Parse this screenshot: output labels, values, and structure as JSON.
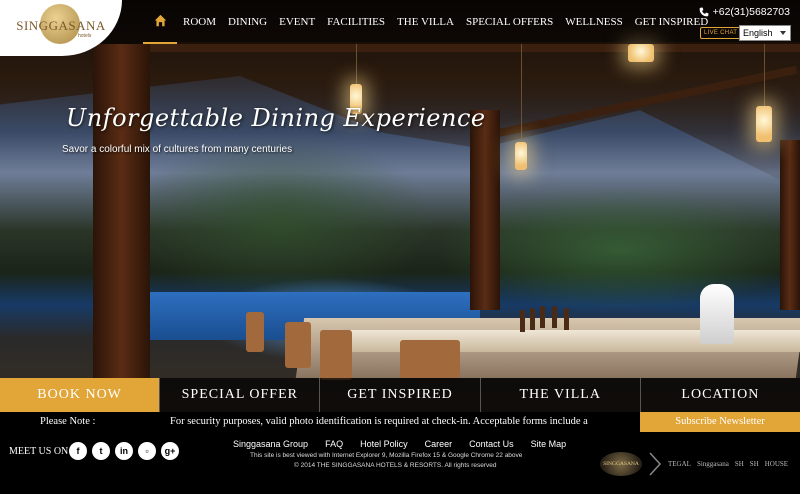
{
  "brand": {
    "logo_text": "SINGGASANA",
    "logo_sub": "hotels"
  },
  "nav": {
    "items": [
      "ROOM",
      "DINING",
      "EVENT",
      "FACILITIES",
      "THE VILLA",
      "SPECIAL OFFERS",
      "WELLNESS",
      "GET INSPIRED"
    ]
  },
  "contact": {
    "phone": "+62(31)5682703",
    "live_chat": "LIVE CHAT",
    "language": "English"
  },
  "hero": {
    "headline": "Unforgettable Dining Experience",
    "subhead": "Savor a colorful mix of cultures from many centuries"
  },
  "tabs": [
    "BOOK NOW",
    "SPECIAL OFFER",
    "GET INSPIRED",
    "THE VILLA",
    "LOCATION"
  ],
  "note": {
    "label": "Please Note :",
    "text": "For security purposes, valid photo identification is required at check-in. Acceptable forms include a",
    "subscribe": "Subscribe Newsletter"
  },
  "footer": {
    "meet_us": "MEET US ON",
    "social": [
      {
        "icon": "facebook-icon",
        "glyph": "f"
      },
      {
        "icon": "twitter-icon",
        "glyph": "t"
      },
      {
        "icon": "linkedin-icon",
        "glyph": "in"
      },
      {
        "icon": "flickr-icon",
        "glyph": "▫"
      },
      {
        "icon": "google-plus-icon",
        "glyph": "g+"
      }
    ],
    "links": [
      "Singgasana Group",
      "FAQ",
      "Hotel Policy",
      "Career",
      "Contact Us",
      "Site Map"
    ],
    "browser_note": "This site is best viewed with Internet Explorer 9, Mozilla Firefox 15 & Google Chrome 22 above",
    "copyright": "© 2014 THE SINGGASANA HOTELS & RESORTS. All rights reserved",
    "partners": [
      "SINGGASANA",
      "TEGAL",
      "Singgasana",
      "SH",
      "SH",
      "HOUSE"
    ]
  },
  "colors": {
    "accent": "#e2a537",
    "bar": "#000000"
  }
}
